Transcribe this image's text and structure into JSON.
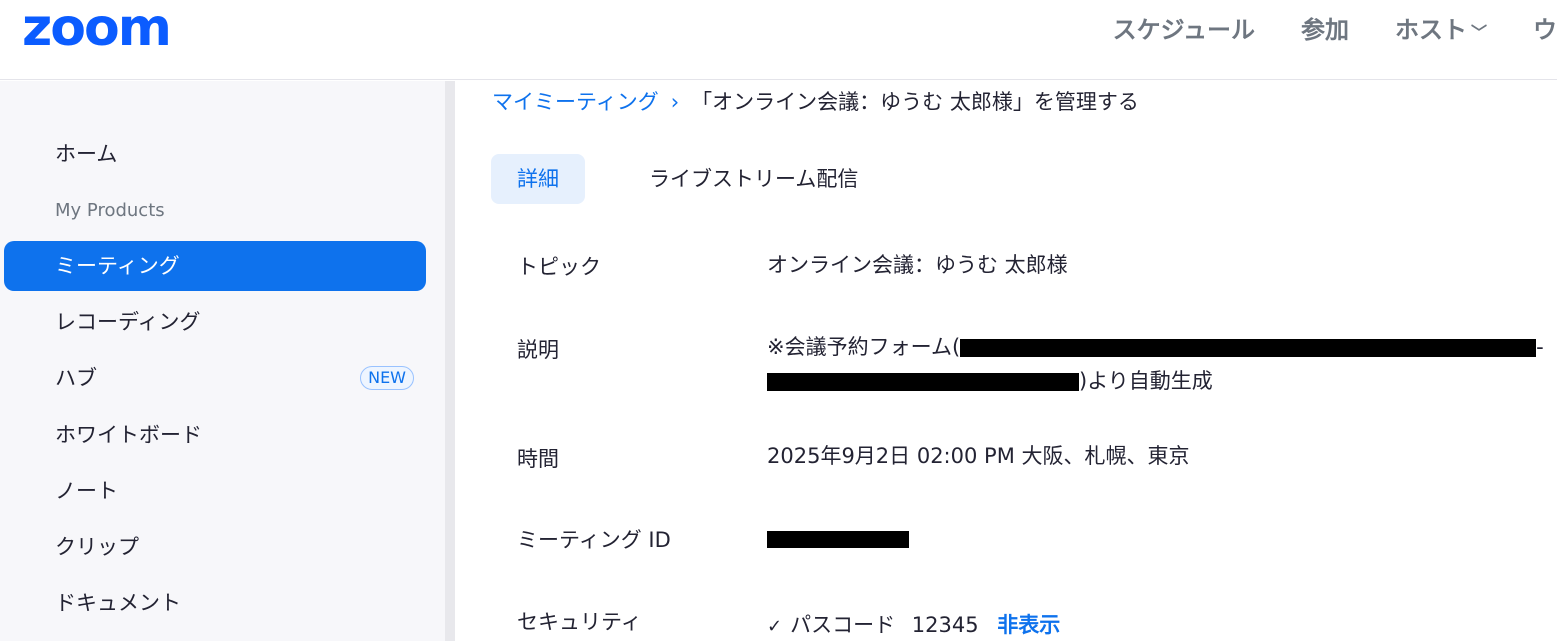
{
  "header": {
    "logo": "zoom",
    "nav": [
      {
        "label": "スケジュール"
      },
      {
        "label": "参加"
      },
      {
        "label": "ホスト"
      },
      {
        "label": "ウ"
      }
    ]
  },
  "sidebar": {
    "items": [
      {
        "label": "ホーム"
      },
      {
        "label": "My Products"
      },
      {
        "label": "ミーティング"
      },
      {
        "label": "レコーディング"
      },
      {
        "label": "ハブ",
        "badge": "NEW"
      },
      {
        "label": "ホワイトボード"
      },
      {
        "label": "ノート"
      },
      {
        "label": "クリップ"
      },
      {
        "label": "ドキュメント"
      }
    ]
  },
  "breadcrumb": {
    "link": "マイミーティング",
    "separator": "›",
    "current": "「オンライン会議：ゆうむ 太郎様」を管理する"
  },
  "tabs": [
    {
      "label": "詳細"
    },
    {
      "label": "ライブストリーム配信"
    }
  ],
  "details": {
    "topic_label": "トピック",
    "topic_value": "オンライン会議：ゆうむ 太郎様",
    "description_label": "説明",
    "description_prefix": "※会議予約フォーム(",
    "description_dash": "-",
    "description_suffix": ")より自動生成",
    "time_label": "時間",
    "time_value": "2025年9月2日 02:00 PM 大阪、札幌、東京",
    "meeting_id_label": "ミーティング ID",
    "security_label": "セキュリティ",
    "passcode_label": "パスコード",
    "passcode_value": "12345",
    "hide_link": "非表示"
  }
}
